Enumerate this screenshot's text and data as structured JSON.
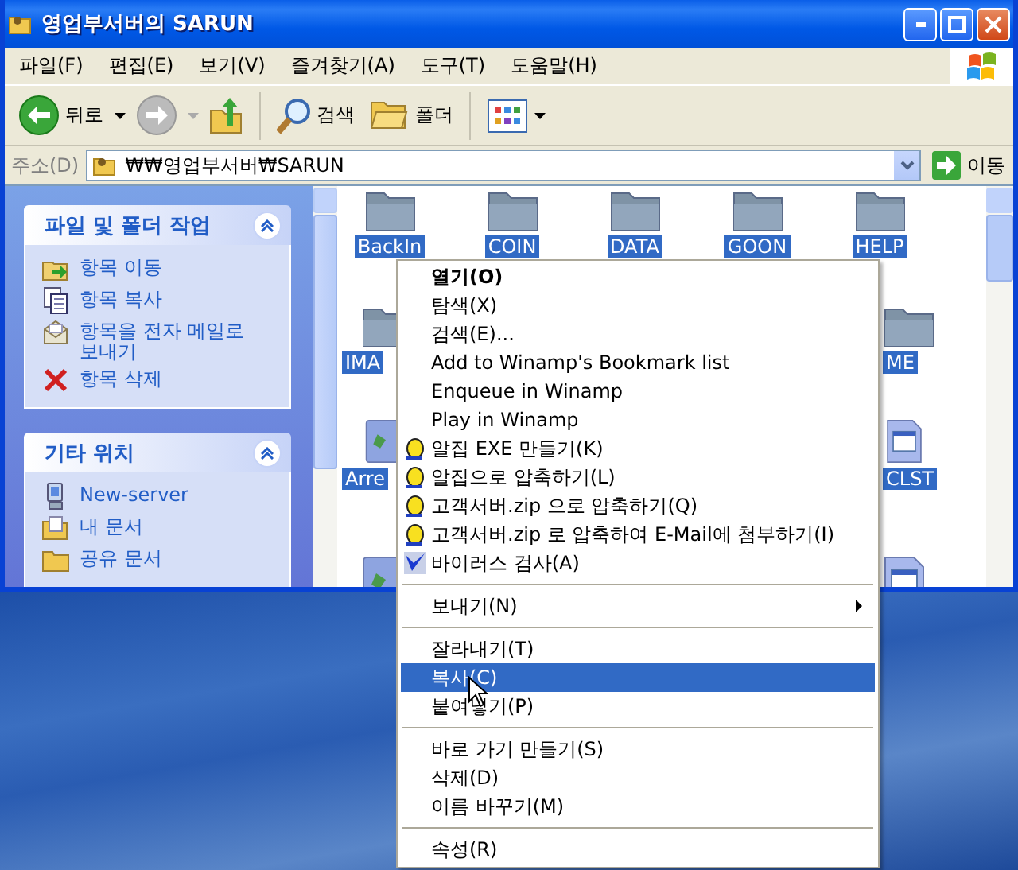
{
  "window": {
    "title": "영업부서버의 SARUN"
  },
  "menu_bar": [
    {
      "label": "파일(F)"
    },
    {
      "label": "편집(E)"
    },
    {
      "label": "보기(V)"
    },
    {
      "label": "즐겨찾기(A)"
    },
    {
      "label": "도구(T)"
    },
    {
      "label": "도움말(H)"
    }
  ],
  "toolbar": {
    "back": "뒤로",
    "search": "검색",
    "folders": "폴더"
  },
  "address_bar": {
    "label": "주소(D)",
    "value": "₩₩영업부서버₩SARUN",
    "go": "이동"
  },
  "sidebar": {
    "panels": [
      {
        "title": "파일 및 폴더 작업",
        "expanded": true,
        "items": [
          {
            "label": "항목 이동",
            "kind": "move"
          },
          {
            "label": "항목 복사",
            "kind": "copy"
          },
          {
            "label": "항목을 전자 메일로 보내기",
            "kind": "mail"
          },
          {
            "label": "항목 삭제",
            "kind": "delete"
          }
        ]
      },
      {
        "title": "기타 위치",
        "expanded": true,
        "items": [
          {
            "label": "New-server",
            "kind": "computer"
          },
          {
            "label": "내 문서",
            "kind": "documents"
          },
          {
            "label": "공유 문서",
            "kind": "folder"
          }
        ]
      }
    ]
  },
  "file_rows": [
    [
      {
        "name": "BackIn",
        "kind": "folder",
        "selected": true
      },
      {
        "name": "COIN",
        "kind": "folder",
        "selected": true
      },
      {
        "name": "DATA",
        "kind": "folder",
        "selected": true
      },
      {
        "name": "GOON",
        "kind": "folder",
        "selected": true
      },
      {
        "name": "HELP",
        "kind": "folder",
        "selected": true
      }
    ],
    [
      {
        "name": "IMA",
        "kind": "folder",
        "selected": true
      },
      {
        "name": "ME",
        "kind": "folder",
        "selected": true
      }
    ],
    [
      {
        "name": "Arre",
        "kind": "program",
        "selected": true
      },
      {
        "name": "CLST",
        "kind": "document",
        "selected": true
      }
    ],
    [
      {
        "kind": "program",
        "selected": true
      },
      {
        "kind": "document",
        "selected": true
      }
    ]
  ],
  "context_menu": {
    "groups": [
      [
        {
          "label": "열기(O)",
          "kind": "plain",
          "default": true,
          "selected": false
        },
        {
          "label": "탐색(X)",
          "kind": "plain",
          "default": false,
          "selected": false
        },
        {
          "label": "검색(E)...",
          "kind": "plain",
          "default": false,
          "selected": false
        },
        {
          "label": "Add to Winamp's Bookmark list",
          "kind": "plain",
          "default": false,
          "selected": false
        },
        {
          "label": "Enqueue in Winamp",
          "kind": "plain",
          "default": false,
          "selected": false
        },
        {
          "label": "Play in Winamp",
          "kind": "plain",
          "default": false,
          "selected": false
        },
        {
          "label": "알집 EXE 만들기(K)",
          "kind": "coin",
          "default": false,
          "selected": false
        },
        {
          "label": "알집으로 압축하기(L)",
          "kind": "coin",
          "default": false,
          "selected": false
        },
        {
          "label": "고객서버.zip 으로 압축하기(Q)",
          "kind": "coin",
          "default": false,
          "selected": false
        },
        {
          "label": "고객서버.zip 로 압축하여 E-Mail에 첨부하기(I)",
          "kind": "coin",
          "default": false,
          "selected": false
        },
        {
          "label": "바이러스 검사(A)",
          "kind": "shield",
          "default": false,
          "selected": false
        }
      ],
      [
        {
          "label": "보내기(N)",
          "kind": "submenu",
          "default": false,
          "selected": false
        }
      ],
      [
        {
          "label": "잘라내기(T)",
          "kind": "plain",
          "default": false,
          "selected": false
        },
        {
          "label": "복사(C)",
          "kind": "plain",
          "default": false,
          "selected": true
        },
        {
          "label": "붙여넣기(P)",
          "kind": "plain",
          "default": false,
          "selected": false
        }
      ],
      [
        {
          "label": "바로 가기 만들기(S)",
          "kind": "plain",
          "default": false,
          "selected": false
        },
        {
          "label": "삭제(D)",
          "kind": "plain",
          "default": false,
          "selected": false
        },
        {
          "label": "이름 바꾸기(M)",
          "kind": "plain",
          "default": false,
          "selected": false
        }
      ],
      [
        {
          "label": "속성(R)",
          "kind": "plain",
          "default": false,
          "selected": false
        }
      ]
    ]
  }
}
